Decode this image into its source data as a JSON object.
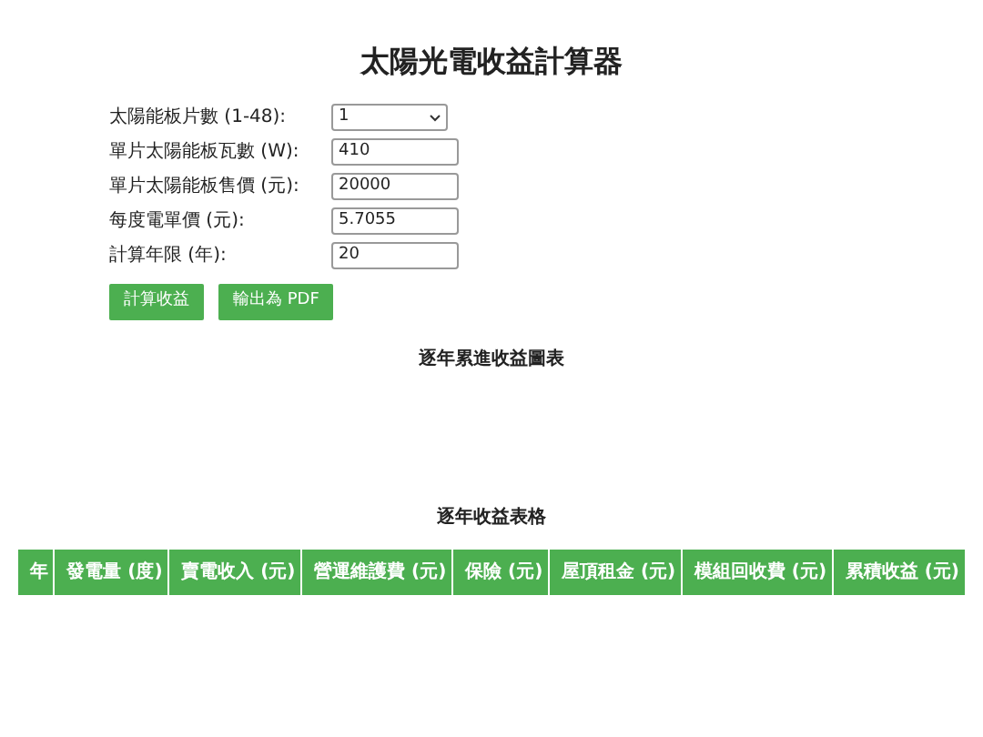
{
  "title": "太陽光電收益計算器",
  "fields": [
    {
      "kind": "select",
      "label": "太陽能板片數 (1-48):",
      "value": "1"
    },
    {
      "kind": "input",
      "label": "單片太陽能板瓦數 (W):",
      "value": "410"
    },
    {
      "kind": "input",
      "label": "單片太陽能板售價 (元):",
      "value": "20000"
    },
    {
      "kind": "input",
      "label": "每度電單價 (元):",
      "value": "5.7055"
    },
    {
      "kind": "input",
      "label": "計算年限 (年):",
      "value": "20"
    }
  ],
  "buttons": [
    "計算收益",
    "輸出為 PDF"
  ],
  "chart_title": "逐年累進收益圖表",
  "table": {
    "title": "逐年收益表格",
    "columns": [
      "年",
      "發電量 (度)",
      "賣電收入 (元)",
      "營運維護費 (元)",
      "保險 (元)",
      "屋頂租金 (元)",
      "模組回收費 (元)",
      "累積收益 (元)"
    ]
  }
}
